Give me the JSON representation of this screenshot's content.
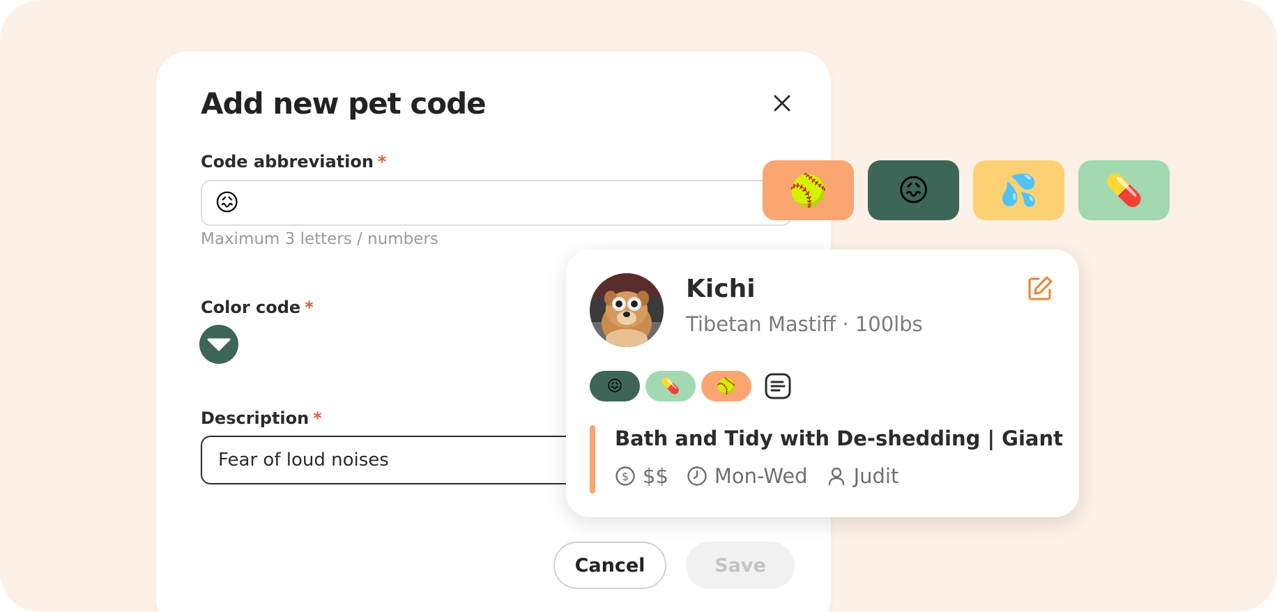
{
  "modal": {
    "title": "Add new pet code",
    "abbreviation": {
      "label": "Code abbreviation",
      "required_mark": "*",
      "value": "😖",
      "helper": "Maximum 3 letters / numbers"
    },
    "color_code": {
      "label": "Color code",
      "required_mark": "*",
      "selected_color": "#3d6558"
    },
    "description": {
      "label": "Description",
      "required_mark": "*",
      "value": "Fear of loud noises"
    },
    "buttons": {
      "cancel": "Cancel",
      "save": "Save"
    }
  },
  "code_tiles": [
    {
      "emoji": "🥎",
      "color": "#fba571"
    },
    {
      "emoji": "😖",
      "color": "#3d6558"
    },
    {
      "emoji": "💦",
      "color": "#fdd174"
    },
    {
      "emoji": "💊",
      "color": "#a2d9b0"
    }
  ],
  "pet_card": {
    "name": "Kichi",
    "meta": "Tibetan Mastiff · 100lbs",
    "chips": [
      {
        "emoji": "😖",
        "color": "#3d6558"
      },
      {
        "emoji": "💊",
        "color": "#a2d9b0"
      },
      {
        "emoji": "🥎",
        "color": "#fba571"
      }
    ],
    "appointment": {
      "title": "Bath and Tidy with De-shedding | Giant",
      "price": "$$",
      "days": "Mon-Wed",
      "staff": "Judit"
    }
  },
  "colors": {
    "background": "#fdf0e7",
    "accent": "#e9842e",
    "required": "#d8613c"
  }
}
